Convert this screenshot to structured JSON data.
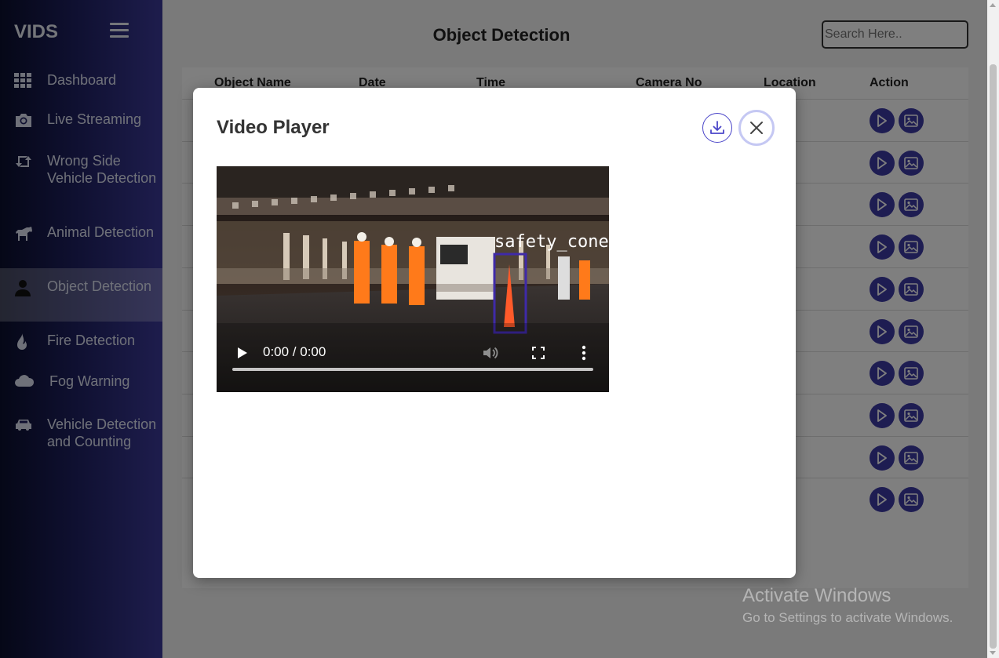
{
  "app": {
    "brand": "VIDS",
    "page_title": "Object Detection",
    "search_placeholder": "Search Here.."
  },
  "sidebar": {
    "items": [
      {
        "label": "Dashboard",
        "icon": "grid-icon"
      },
      {
        "label": "Live Streaming",
        "icon": "camera-icon"
      },
      {
        "label": "Wrong Side Vehicle Detection",
        "icon": "retweet-icon"
      },
      {
        "label": "Animal Detection",
        "icon": "horse-icon"
      },
      {
        "label": "Object Detection",
        "icon": "user-icon",
        "active": true
      },
      {
        "label": "Fire Detection",
        "icon": "fire-icon"
      },
      {
        "label": "Fog Warning",
        "icon": "cloud-icon"
      },
      {
        "label": "Vehicle Detection and Counting",
        "icon": "car-icon"
      }
    ]
  },
  "table": {
    "headers": [
      "Object Name",
      "Date",
      "Time",
      "Camera No",
      "Location",
      "Action"
    ],
    "row_count": 10
  },
  "modal": {
    "title": "Video Player",
    "video": {
      "time": "0:00 / 0:00",
      "overlay_label": "safety_cone"
    }
  },
  "watermark": {
    "title": "Activate Windows",
    "subtitle": "Go to Settings to activate Windows."
  },
  "colors": {
    "accent": "#3d3aa5",
    "sidebar_dark": "#0b0f2e",
    "sidebar_light": "#3c3a9a"
  }
}
